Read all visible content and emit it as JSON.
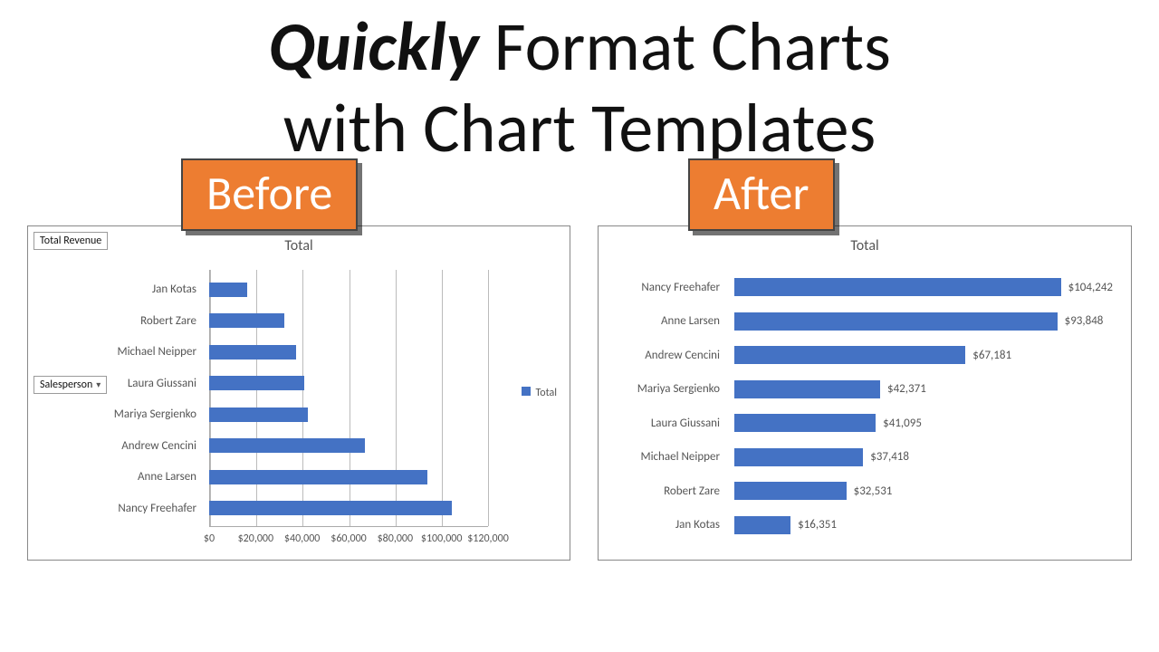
{
  "heading": {
    "emph": "Quickly",
    "line1_rest": " Format Charts",
    "line2": "with Chart Templates"
  },
  "badges": {
    "before": "Before",
    "after": "After"
  },
  "fields": {
    "total_revenue": "Total Revenue",
    "salesperson": "Salesperson"
  },
  "legend": {
    "total": "Total"
  },
  "chart_data": [
    {
      "id": "before",
      "type": "bar",
      "orientation": "horizontal",
      "title": "Total",
      "xlabel": "",
      "ylabel": "",
      "xlim": [
        0,
        120000
      ],
      "x_ticks": [
        0,
        20000,
        40000,
        60000,
        80000,
        100000,
        120000
      ],
      "x_tick_labels": [
        "$0",
        "$20,000",
        "$40,000",
        "$60,000",
        "$80,000",
        "$100,000",
        "$120,000"
      ],
      "categories": [
        "Jan Kotas",
        "Robert Zare",
        "Michael Neipper",
        "Laura Giussani",
        "Mariya Sergienko",
        "Andrew Cencini",
        "Anne Larsen",
        "Nancy Freehafer"
      ],
      "series": [
        {
          "name": "Total",
          "color": "#4472c4",
          "values": [
            16351,
            32531,
            37418,
            41095,
            42371,
            67181,
            93848,
            104242
          ]
        }
      ],
      "legend_text": "Total"
    },
    {
      "id": "after",
      "type": "bar",
      "orientation": "horizontal",
      "title": "Total",
      "xlabel": "",
      "ylabel": "",
      "xlim": [
        0,
        110000
      ],
      "grid": false,
      "categories": [
        "Nancy Freehafer",
        "Anne Larsen",
        "Andrew Cencini",
        "Mariya Sergienko",
        "Laura Giussani",
        "Michael Neipper",
        "Robert Zare",
        "Jan Kotas"
      ],
      "series": [
        {
          "name": "Total",
          "color": "#4472c4",
          "values": [
            104242,
            93848,
            67181,
            42371,
            41095,
            37418,
            32531,
            16351
          ]
        }
      ],
      "data_labels": [
        "$104,242",
        "$93,848",
        "$67,181",
        "$42,371",
        "$41,095",
        "$37,418",
        "$32,531",
        "$16,351"
      ]
    }
  ]
}
